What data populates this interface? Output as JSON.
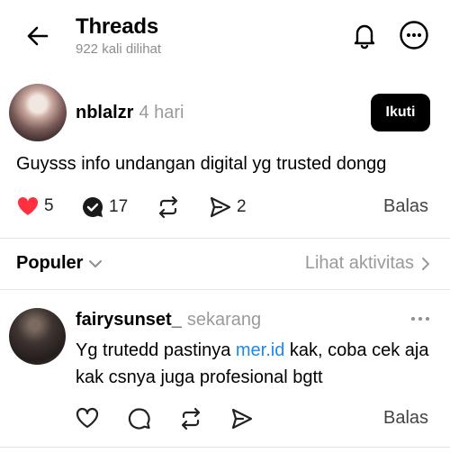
{
  "header": {
    "title": "Threads",
    "views": "922 kali dilihat"
  },
  "post": {
    "username": "nblalzr",
    "time": "4 hari",
    "follow_label": "Ikuti",
    "text": "Guysss info undangan digital yg trusted dongg",
    "likes": "5",
    "comments": "17",
    "shares": "2",
    "reply_label": "Balas"
  },
  "sort": {
    "label": "Populer",
    "activity_label": "Lihat aktivitas"
  },
  "reply": {
    "username": "fairysunset_",
    "time": "sekarang",
    "text_before": "Yg trutedd pastinya ",
    "link": "mer.id",
    "text_after": " kak, coba cek aja kak csnya juga profesional bgtt",
    "reply_label": "Balas"
  },
  "colors": {
    "like": "#ff3040",
    "link": "#1a8be8",
    "muted": "#9a9a9a"
  },
  "icons": [
    "back-arrow-icon",
    "bell-icon",
    "more-icon",
    "heart-icon",
    "comment-icon",
    "repost-icon",
    "share-icon",
    "chevron-down-icon",
    "chevron-right-icon"
  ]
}
